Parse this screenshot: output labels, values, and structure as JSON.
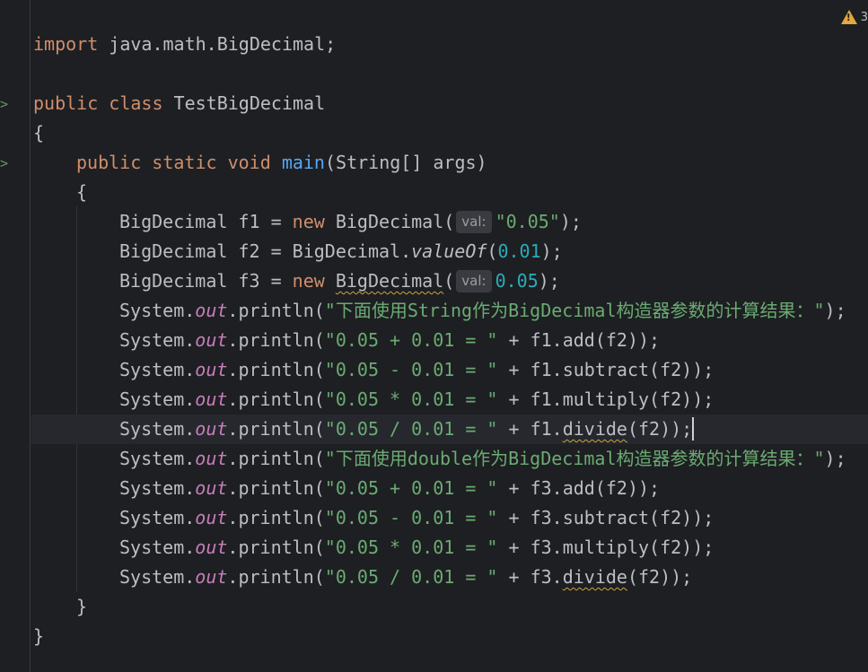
{
  "warning_count": "3",
  "hint_label": "val:",
  "code": {
    "import_kw": "import",
    "import_rest": " java.math.BigDecimal;",
    "public_kw": "public",
    "class_kw": "class",
    "class_name": " TestBigDecimal",
    "open_brace": "{",
    "close_brace": "}",
    "static_kw": "static",
    "void_kw": "void",
    "main_name": "main",
    "main_params": "(String[] args)",
    "l1_a": "BigDecimal f1 = ",
    "new_kw": "new",
    "l1_b": " BigDecimal(",
    "l1_str": "\"0.05\"",
    "l1_end": ");",
    "l2_a": "BigDecimal f2 = BigDecimal.",
    "l2_method": "valueOf",
    "l2_open": "(",
    "l2_num": "0.01",
    "l2_end": ");",
    "l3_a": "BigDecimal f3 = ",
    "l3_space": " ",
    "l3_type": "BigDecimal",
    "l3_open": "(",
    "l3_num": "0.05",
    "l3_end": ");",
    "system": "System.",
    "out": "out",
    "println": ".println(",
    "msg_string": "\"下面使用String作为BigDecimal构造器参数的计算结果：\"",
    "msg_double": "\"下面使用double作为BigDecimal构造器参数的计算结果：\"",
    "str_add": "\"0.05 + 0.01 = \"",
    "str_sub": "\"0.05 - 0.01 = \"",
    "str_mul": "\"0.05 * 0.01 = \"",
    "str_div": "\"0.05 / 0.01 = \"",
    "close_call": ");",
    "f1_add": " + f1.add(f2));",
    "f1_sub": " + f1.subtract(f2));",
    "f1_mul": " + f1.multiply(f2));",
    "f1_div_a": " + f1.",
    "div_name": "divide",
    "div_b": "(f2));",
    "f3_add": " + f3.add(f2));",
    "f3_sub": " + f3.subtract(f2));",
    "f3_mul": " + f3.multiply(f2));",
    "f3_div_a": " + f3."
  }
}
